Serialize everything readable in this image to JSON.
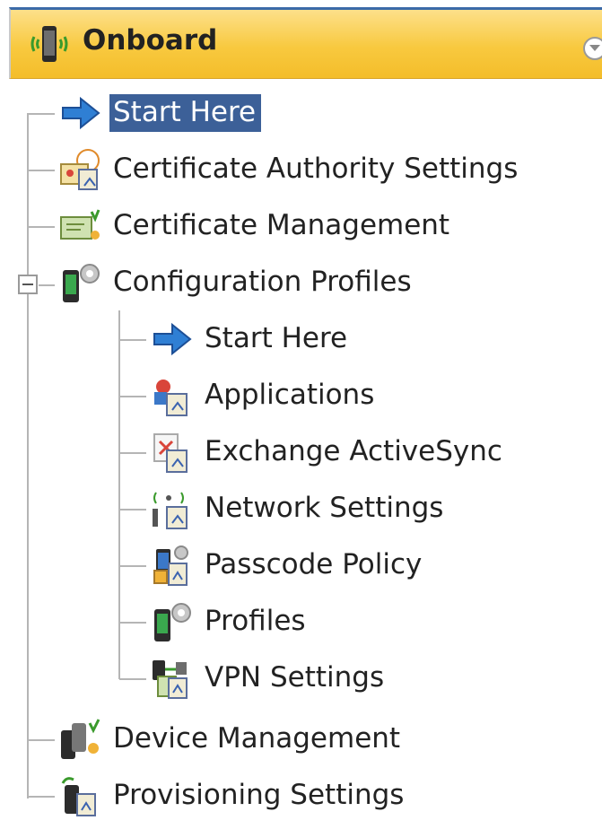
{
  "panel": {
    "title": "Onboard",
    "header_icon": "phone-signal-icon",
    "collapse_icon": "chevron-down-icon"
  },
  "tree": {
    "items": [
      {
        "label": "Start Here",
        "icon": "arrow-right-icon",
        "selected": true
      },
      {
        "label": "Certificate Authority Settings",
        "icon": "certificate-authority-icon"
      },
      {
        "label": "Certificate Management",
        "icon": "certificate-icon"
      },
      {
        "label": "Configuration Profiles",
        "icon": "phone-gear-icon",
        "expanded": true,
        "children": [
          {
            "label": "Start Here",
            "icon": "arrow-right-icon"
          },
          {
            "label": "Applications",
            "icon": "applications-icon"
          },
          {
            "label": "Exchange ActiveSync",
            "icon": "exchange-icon"
          },
          {
            "label": "Network Settings",
            "icon": "network-icon"
          },
          {
            "label": "Passcode Policy",
            "icon": "lock-icon"
          },
          {
            "label": "Profiles",
            "icon": "phone-gear-icon"
          },
          {
            "label": "VPN Settings",
            "icon": "vpn-icon"
          }
        ]
      },
      {
        "label": "Device Management",
        "icon": "devices-icon"
      },
      {
        "label": "Provisioning Settings",
        "icon": "provisioning-icon"
      }
    ]
  },
  "colors": {
    "header_bg": "#f8c93f",
    "selection": "#3c6098",
    "tree_line": "#b5b5b5"
  }
}
